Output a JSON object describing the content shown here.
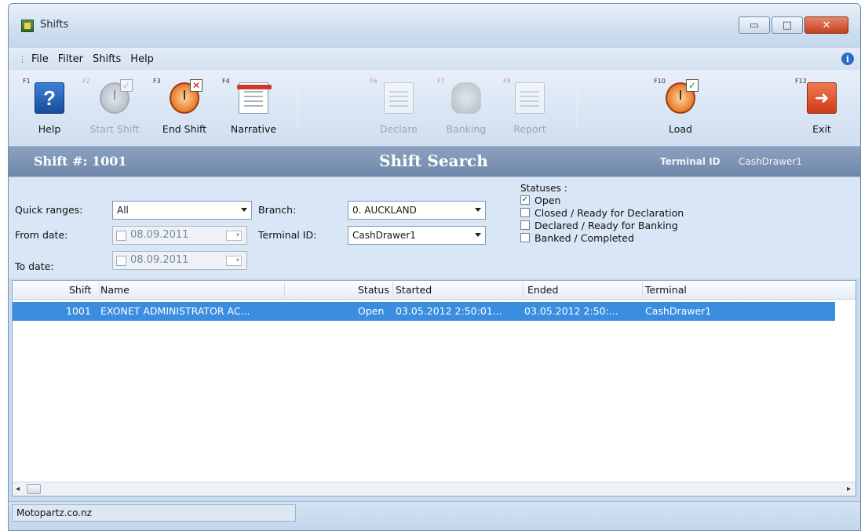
{
  "window": {
    "title": "Shifts"
  },
  "menu": [
    "File",
    "Filter",
    "Shifts",
    "Help"
  ],
  "toolbar": {
    "help": {
      "key": "F1",
      "label": "Help"
    },
    "start_shift": {
      "key": "F2",
      "label": "Start Shift"
    },
    "end_shift": {
      "key": "F3",
      "label": "End Shift"
    },
    "narrative": {
      "key": "F4",
      "label": "Narrative"
    },
    "declare": {
      "key": "F6",
      "label": "Declare"
    },
    "banking": {
      "key": "F7",
      "label": "Banking"
    },
    "report": {
      "key": "F8",
      "label": "Report"
    },
    "load": {
      "key": "F10",
      "label": "Load"
    },
    "exit": {
      "key": "F12",
      "label": "Exit"
    }
  },
  "header": {
    "shift_number": "Shift #: 1001",
    "title": "Shift Search",
    "terminal_label": "Terminal ID",
    "terminal_value": "CashDrawer1"
  },
  "filters": {
    "quick_ranges_label": "Quick ranges:",
    "quick_ranges_value": "All",
    "from_date_label": "From date:",
    "from_date_value": "08.09.2011",
    "to_date_label": "To date:",
    "to_date_value": "08.09.2011",
    "branch_label": "Branch:",
    "branch_value": "0. AUCKLAND",
    "terminal_label": "Terminal ID:",
    "terminal_value": "CashDrawer1",
    "statuses_title": "Statuses :",
    "statuses": [
      {
        "label": "Open",
        "checked": true
      },
      {
        "label": "Closed / Ready for Declaration",
        "checked": false
      },
      {
        "label": "Declared / Ready for Banking",
        "checked": false
      },
      {
        "label": "Banked / Completed",
        "checked": false
      }
    ]
  },
  "table": {
    "columns": [
      "Shift",
      "Name",
      "Status",
      "Started",
      "Ended",
      "Terminal"
    ],
    "rows": [
      {
        "shift": "1001",
        "name": "EXONET ADMINISTRATOR AC...",
        "status": "Open",
        "started": "03.05.2012 2:50:01...",
        "ended": "03.05.2012 2:50:...",
        "terminal": "CashDrawer1"
      }
    ]
  },
  "statusbar": {
    "text": "Motopartz.co.nz"
  },
  "colors": {
    "selection": "#3b8de0",
    "header_band": "#7a90b2"
  }
}
